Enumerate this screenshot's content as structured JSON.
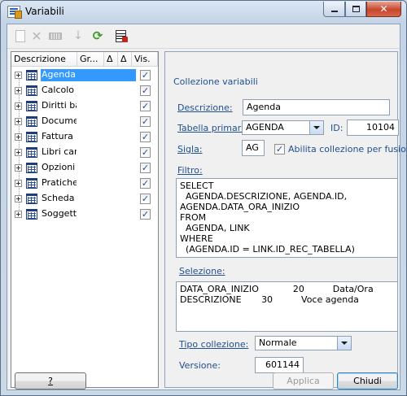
{
  "window": {
    "title": "Variabili"
  },
  "toolbar": [
    {
      "name": "new-icon",
      "enabled": false
    },
    {
      "name": "delete-icon",
      "enabled": false
    },
    {
      "name": "edit-icon",
      "enabled": false
    },
    {
      "name": "move-down-icon",
      "enabled": false
    },
    {
      "name": "refresh-icon",
      "enabled": true
    },
    {
      "name": "document-icon",
      "enabled": true
    }
  ],
  "tree": {
    "columns": [
      "Descrizione",
      "Gr...",
      "Δ",
      "Δ",
      "Vis."
    ],
    "rows": [
      {
        "label": "Agenda",
        "visible": true,
        "selected": true
      },
      {
        "label": "Calcolo",
        "visible": true,
        "selected": false
      },
      {
        "label": "Diritti ba",
        "visible": true,
        "selected": false
      },
      {
        "label": "Docume",
        "visible": true,
        "selected": false
      },
      {
        "label": "Fattura",
        "visible": true,
        "selected": false
      },
      {
        "label": "Libri cari",
        "visible": true,
        "selected": false
      },
      {
        "label": "Opzioni",
        "visible": true,
        "selected": false
      },
      {
        "label": "Pratiche",
        "visible": true,
        "selected": false
      },
      {
        "label": "Scheda",
        "visible": true,
        "selected": false
      },
      {
        "label": "Soggetti",
        "visible": true,
        "selected": false
      }
    ]
  },
  "form": {
    "section_title": "Collezione variabili",
    "descrizione_label": "Descrizione:",
    "descrizione_value": "Agenda",
    "tabella_label": "Tabella primaria:",
    "tabella_value": "AGENDA",
    "id_label": "ID:",
    "id_value": "10104",
    "sigla_label": "Sigla:",
    "sigla_value": "AG",
    "abilita_label": "Abilita collezione per fusione",
    "abilita_checked": true,
    "filtro_label": "Filtro:",
    "filtro_value": "SELECT\n  AGENDA.DESCRIZIONE, AGENDA.ID,\nAGENDA.DATA_ORA_INIZIO\nFROM\n  AGENDA, LINK\nWHERE\n  (AGENDA.ID = LINK.ID_REC_TABELLA)",
    "selezione_label": "Selezione:",
    "selezione_value": "DATA_ORA_INIZIO            20          Data/Ora\nDESCRIZIONE       30          Voce agenda",
    "tipo_label": "Tipo collezione:",
    "tipo_value": "Normale",
    "versione_label": "Versione:",
    "versione_value": "601144"
  },
  "buttons": {
    "help": "?",
    "apply": "Applica",
    "close": "Chiudi"
  },
  "colors": {
    "label": "#1e4f91",
    "selection": "#3399ff",
    "close_button": "#c7472d"
  }
}
